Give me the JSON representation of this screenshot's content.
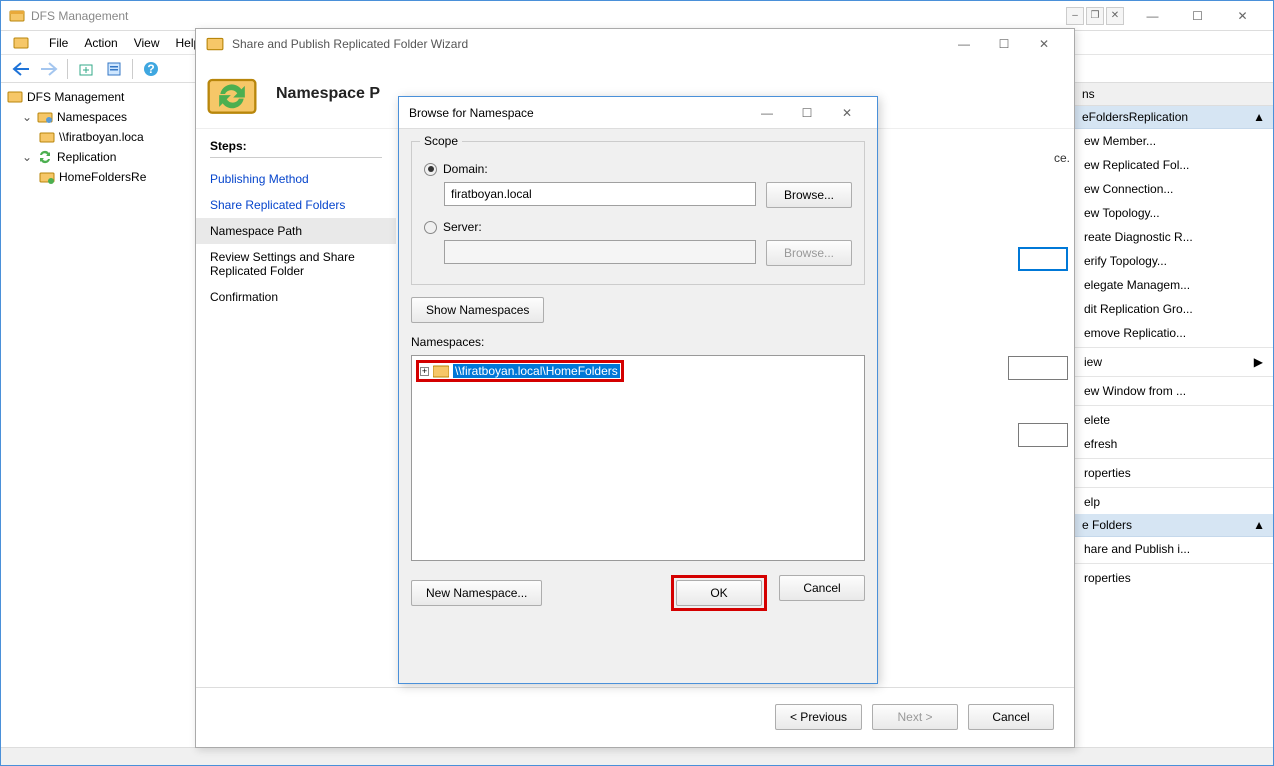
{
  "main_window": {
    "title": "DFS Management",
    "menu": {
      "file": "File",
      "action": "Action",
      "view": "View",
      "help": "Help"
    }
  },
  "tree": {
    "root": "DFS Management",
    "namespaces": "Namespaces",
    "ns_path": "\\\\firatboyan.loca",
    "replication": "Replication",
    "repl_group": "HomeFoldersRe"
  },
  "actions_panel": {
    "header": "ns",
    "group1": "eFoldersReplication",
    "items1": [
      "ew Member...",
      "ew Replicated Fol...",
      "ew Connection...",
      "ew Topology...",
      "reate Diagnostic R...",
      "erify Topology...",
      "elegate Managem...",
      "dit Replication Gro...",
      "emove Replicatio..."
    ],
    "view": "iew",
    "items2": [
      "ew Window from ...",
      "elete",
      "efresh",
      "roperties",
      "elp"
    ],
    "group2": "e Folders",
    "items3": [
      "hare and Publish i...",
      "roperties"
    ]
  },
  "wizard": {
    "title": "Share and Publish Replicated Folder Wizard",
    "heading": "Namespace P",
    "steps_hdr": "Steps:",
    "steps": [
      "Publishing Method",
      "Share Replicated Folders",
      "Namespace Path",
      "Review Settings and Share Replicated Folder",
      "Confirmation"
    ],
    "trailing_text": "ce.",
    "footer": {
      "prev": "< Previous",
      "next": "Next >",
      "cancel": "Cancel"
    }
  },
  "dialog": {
    "title": "Browse for Namespace",
    "scope_label": "Scope",
    "domain_label": "Domain:",
    "domain_value": "firatboyan.local",
    "server_label": "Server:",
    "browse": "Browse...",
    "show_ns": "Show Namespaces",
    "ns_label": "Namespaces:",
    "ns_item": "\\\\firatboyan.local\\HomeFolders",
    "new_ns": "New Namespace...",
    "ok": "OK",
    "cancel": "Cancel"
  }
}
